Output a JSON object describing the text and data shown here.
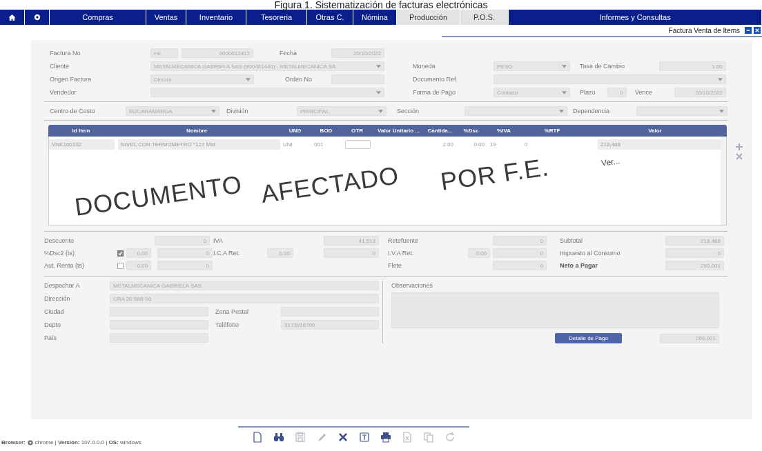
{
  "caption": "Figura 1. Sistematización de facturas electrónicas",
  "menu": [
    {
      "label": "Compras",
      "highlighted": false
    },
    {
      "label": "Ventas",
      "highlighted": false
    },
    {
      "label": "Inventario",
      "highlighted": false
    },
    {
      "label": "Tesoreria",
      "highlighted": false
    },
    {
      "label": "Otras C.",
      "highlighted": false
    },
    {
      "label": "Nómina",
      "highlighted": false
    },
    {
      "label": "Producción",
      "highlighted": true
    },
    {
      "label": "P.O.S.",
      "highlighted": true
    },
    {
      "label": "Informes y Consultas",
      "highlighted": false
    }
  ],
  "window_title": "Factura Venta de Items",
  "header": {
    "factura_no": {
      "label": "Factura No",
      "prefix": "FE",
      "value": "0000012412"
    },
    "fecha": {
      "label": "Fecha",
      "value": "20/10/2022"
    },
    "cliente": {
      "label": "Cliente",
      "kind": "select",
      "value": "METALMECANICA GABRIELA SAS (900461440) - METALMECANICA SA"
    },
    "origen": {
      "label": "Origen Factura",
      "kind": "select",
      "value": "Directa"
    },
    "orden_no": {
      "label": "Orden No"
    },
    "vendedor": {
      "label": "Vendedor",
      "kind": "select"
    },
    "moneda": {
      "label": "Moneda",
      "kind": "select",
      "value": "PESO"
    },
    "tasa": {
      "label": "Tasa de Cambio",
      "value": "1.00"
    },
    "documento_ref": {
      "label": "Documento Ref.",
      "kind": "select"
    },
    "forma_pago": {
      "label": "Forma de Pago",
      "kind": "select",
      "value": "Contado"
    },
    "plazo": {
      "label": "Plazo",
      "value": "0"
    },
    "vence": {
      "label": "Vence",
      "value": "20/10/2022"
    },
    "centro": {
      "label": "Centro de Costo",
      "kind": "select",
      "value": "BUCARAMANGA"
    },
    "division": {
      "label": "División",
      "kind": "select",
      "value": "PRINCIPAL"
    },
    "seccion": {
      "label": "Sección",
      "kind": "select"
    },
    "dependencia": {
      "label": "Dependencia",
      "kind": "select"
    }
  },
  "table": {
    "columns": [
      "Id Item",
      "Nombre",
      "UND",
      "BOD",
      "OTR",
      "Valor Unitario ...",
      "Cantida...",
      "%Dsc",
      "%IVA",
      "%RTF",
      "Valor"
    ],
    "rows": [
      {
        "id": "VNK160102",
        "nombre": "NIVEL CON TERMOMETRO *127 MM",
        "und": "UNI",
        "bod": "001",
        "cantidad": "2.00",
        "dsc": "0.00",
        "iva": "19",
        "rtf": "0",
        "valor": "218,488"
      }
    ]
  },
  "totals": {
    "descuento": {
      "label": "Descuento",
      "value": "0"
    },
    "dsc2": {
      "label": "%Dsc2 (ts)",
      "checked": true,
      "percent": "0.00",
      "value": "0"
    },
    "aut_renta": {
      "label": "Aut. Renta (ts)",
      "checked": false,
      "percent": "0.00",
      "value": "0"
    },
    "iva": {
      "label": "IVA",
      "value": "41,513"
    },
    "ica_ret": {
      "label": "I.C.A Ret.",
      "percent": "0.00",
      "value": "0"
    },
    "retefuente": {
      "label": "Retefuente",
      "value": "0"
    },
    "iva_ret": {
      "label": "I.V.A Ret.",
      "percent": "0.00",
      "value": "0"
    },
    "flete": {
      "label": "Flete",
      "value": "0"
    },
    "subtotal": {
      "label": "Subtotal",
      "value": "218,488"
    },
    "impuesto_consumo": {
      "label": "Impuesto al Consumo",
      "value": "0"
    },
    "neto": {
      "label": "Neto a Pagar",
      "value": "260,001"
    }
  },
  "shipping": {
    "despachar": {
      "label": "Despachar A",
      "value": "METALMECANICA GABRIELA SAS"
    },
    "direccion": {
      "label": "Dirección",
      "value": "CRA 20 56B 06"
    },
    "ciudad": {
      "label": "Ciudad"
    },
    "zona_postal": {
      "label": "Zona Postal"
    },
    "depto": {
      "label": "Depto"
    },
    "telefono": {
      "label": "Teléfono",
      "value": "3173916700"
    },
    "pais": {
      "label": "País"
    }
  },
  "observaciones": {
    "label": "Observaciones"
  },
  "payment": {
    "button": "Detalle de Pago",
    "value": "260,001"
  },
  "stamp": {
    "words": [
      "DOCUMENTO",
      "AFECTADO",
      "POR F.E."
    ],
    "note": "Ver..."
  },
  "toolbar": [
    {
      "disabled": false
    },
    {
      "disabled": false
    },
    {
      "disabled": true
    },
    {
      "disabled": true
    },
    {
      "disabled": false
    },
    {
      "disabled": false
    },
    {
      "disabled": false
    },
    {
      "disabled": true
    },
    {
      "disabled": true
    },
    {
      "disabled": true
    }
  ],
  "footer": {
    "browser_label": "**Browser:**",
    "info": "chrome | **Versión:** 107.0.0.0 | **OS:** windows"
  }
}
